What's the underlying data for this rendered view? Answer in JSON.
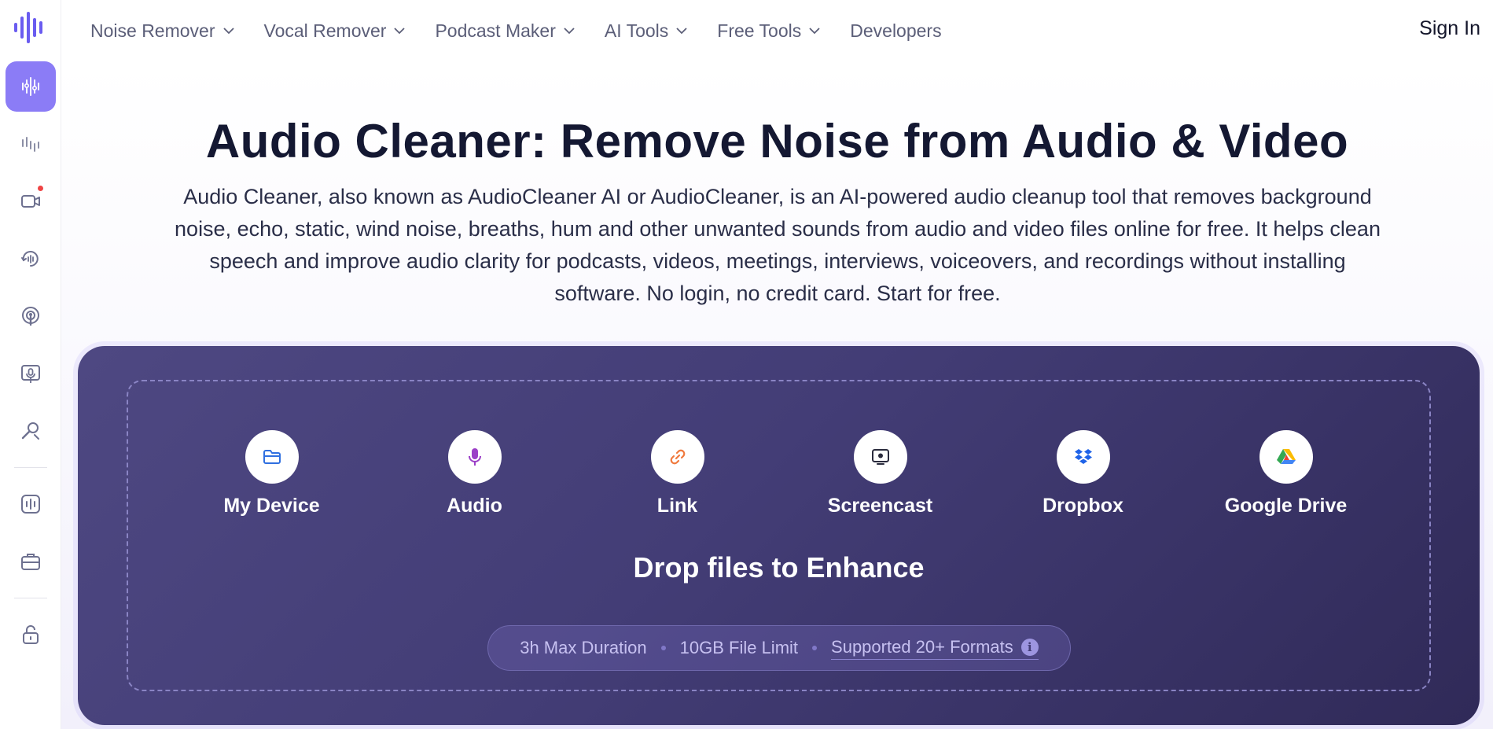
{
  "nav": {
    "items": [
      {
        "label": "Noise Remover",
        "has_dropdown": true
      },
      {
        "label": "Vocal Remover",
        "has_dropdown": true
      },
      {
        "label": "Podcast Maker",
        "has_dropdown": true
      },
      {
        "label": "AI Tools",
        "has_dropdown": true
      },
      {
        "label": "Free Tools",
        "has_dropdown": true
      },
      {
        "label": "Developers",
        "has_dropdown": false
      }
    ],
    "sign_in": "Sign In"
  },
  "sidebar": {
    "icons": [
      "audio-wave-logo-icon",
      "equalizer-icon",
      "waveform-icon",
      "video-camera-icon",
      "speed-icon",
      "podcast-icon",
      "screen-mic-icon",
      "search-mic-icon",
      "audio-frame-icon",
      "toolbox-icon",
      "lock-icon"
    ]
  },
  "hero": {
    "title": "Audio Cleaner: Remove Noise from Audio & Video",
    "subtitle": "Audio Cleaner, also known as AudioCleaner AI or AudioCleaner, is an AI-powered audio cleanup tool that removes background noise, echo, static, wind noise, breaths, hum and other unwanted sounds from audio and video files online for free. It helps clean speech and improve audio clarity for podcasts, videos, meetings, interviews, voiceovers, and recordings without installing software. No login, no credit card. Start for free."
  },
  "upload": {
    "sources": [
      {
        "label": "My Device",
        "icon": "folder-icon",
        "color": "#2f6fe0"
      },
      {
        "label": "Audio",
        "icon": "microphone-icon",
        "color": "#9b3fc7"
      },
      {
        "label": "Link",
        "icon": "link-icon",
        "color": "#f07a3e"
      },
      {
        "label": "Screencast",
        "icon": "screen-record-icon",
        "color": "#2a2b3d"
      },
      {
        "label": "Dropbox",
        "icon": "dropbox-icon",
        "color": "#1f63e8"
      },
      {
        "label": "Google Drive",
        "icon": "google-drive-icon",
        "color": "#34a853"
      }
    ],
    "drop_text": "Drop files to Enhance",
    "limits": {
      "duration": "3h Max Duration",
      "size": "10GB File Limit",
      "formats": "Supported 20+ Formats"
    }
  },
  "colors": {
    "accent": "#8b7cf6",
    "card_bg": "#433d76"
  }
}
